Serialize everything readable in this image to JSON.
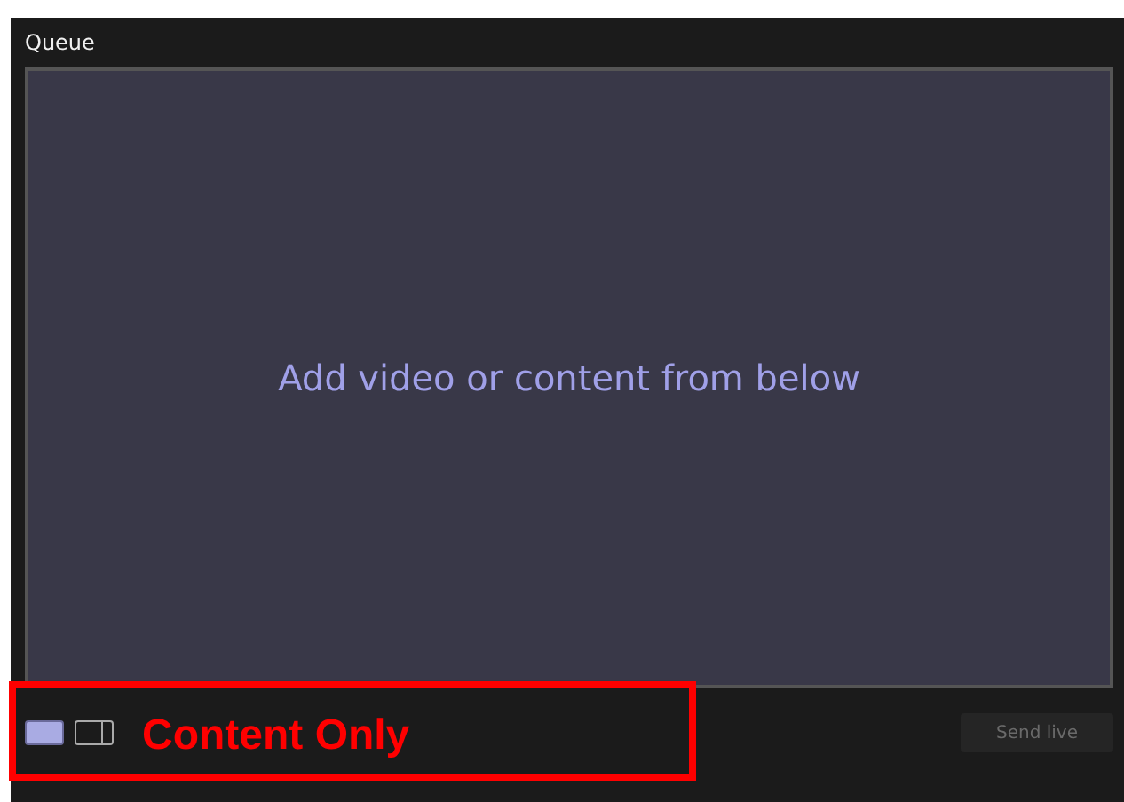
{
  "window": {
    "title": "Queue"
  },
  "preview": {
    "message": "Add video or content from below"
  },
  "layouts": [
    {
      "kind": "content-only",
      "selected": true
    },
    {
      "kind": "content-and-camera",
      "selected": false
    }
  ],
  "annotation": {
    "label": "Content Only"
  },
  "send_button": {
    "label": "Send live",
    "disabled": true
  }
}
